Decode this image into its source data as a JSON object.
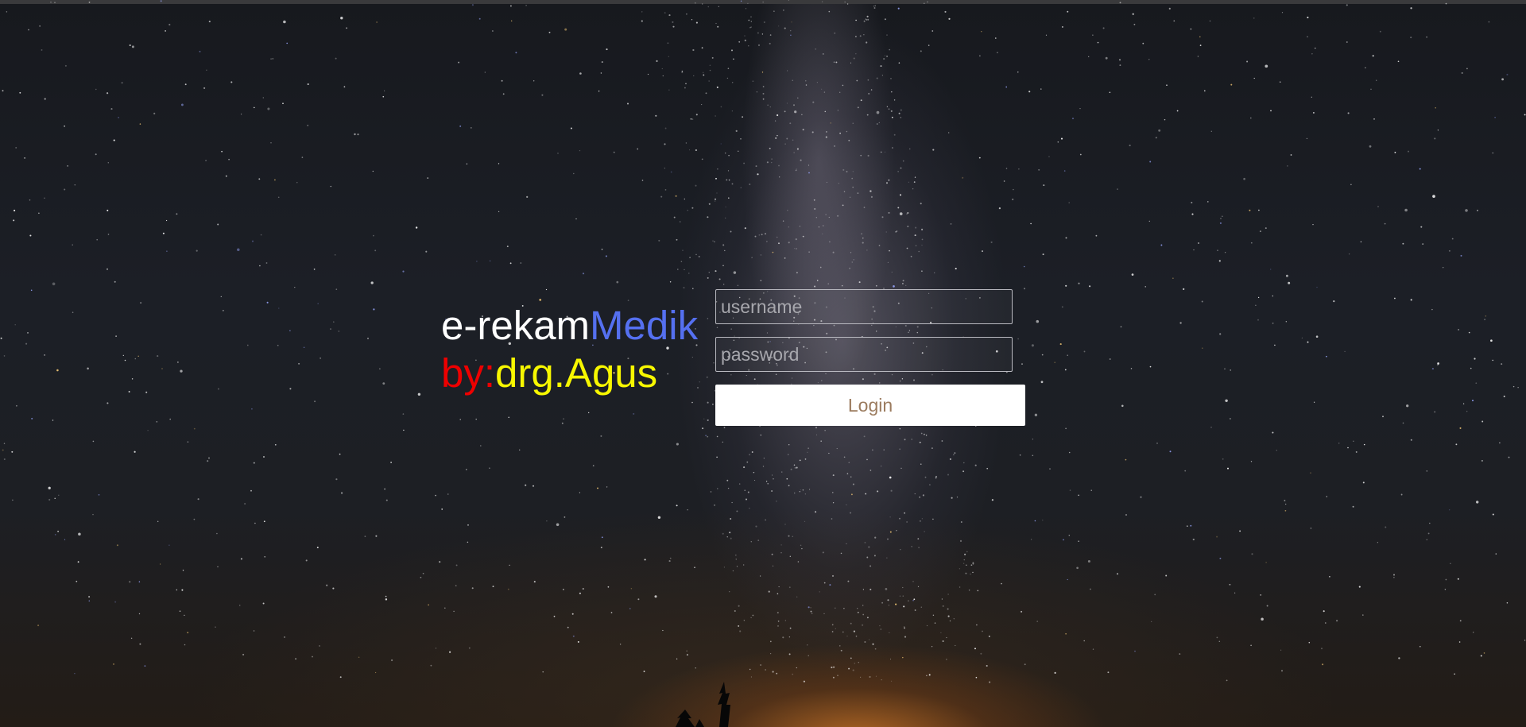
{
  "brand": {
    "line1_part1": "e-rekam",
    "line1_part2": "Medik",
    "line2_part1": "by:",
    "line2_part2": "drg.Agus"
  },
  "form": {
    "username_placeholder": "username",
    "username_value": "",
    "password_placeholder": "password",
    "password_value": "",
    "login_label": "Login"
  },
  "colors": {
    "brand_white": "#ffffff",
    "brand_blue": "#5570f0",
    "brand_red": "#ee0000",
    "brand_yellow": "#f7f700",
    "button_text": "#9b7b5e"
  }
}
